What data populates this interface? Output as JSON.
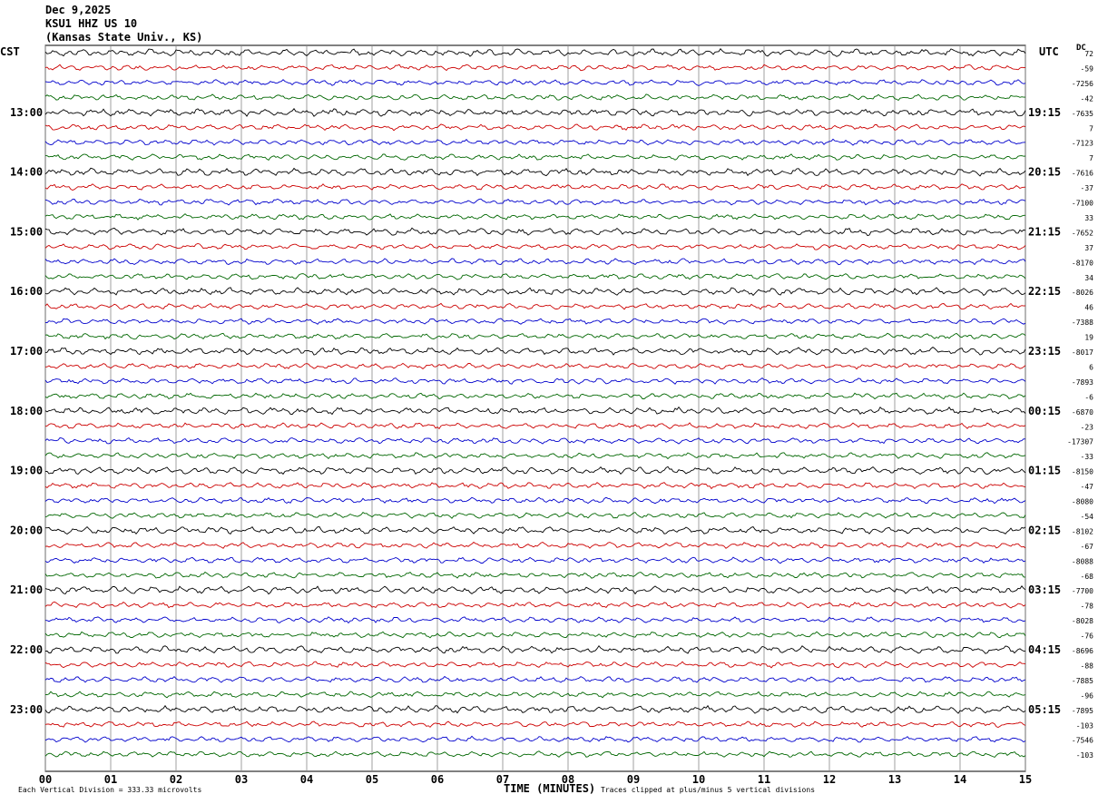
{
  "header": {
    "date": "Dec 9,2025",
    "station": "KSU1 HHZ US 10",
    "location": "(Kansas State Univ., KS)"
  },
  "left_zone_label": "CST",
  "right_zone_label": "UTC",
  "dc_label": "DC",
  "footer": {
    "scale_note": "Each Vertical Division =  333.33 microvolts",
    "xlabel": "TIME (MINUTES)",
    "clip_note": "Traces clipped at plus/minus 5 vertical divisions"
  },
  "colors": {
    "trace_cycle": [
      "#000000",
      "#cc0000",
      "#0000cc",
      "#006600"
    ],
    "grid": "#888888"
  },
  "chart_data": {
    "type": "line",
    "title": "",
    "xlabel": "TIME (MINUTES)",
    "xlim": [
      0,
      15
    ],
    "x_ticks": [
      "00",
      "01",
      "02",
      "03",
      "04",
      "05",
      "06",
      "07",
      "08",
      "09",
      "10",
      "11",
      "12",
      "13",
      "14",
      "15"
    ],
    "rows_per_hour": 4,
    "minutes_per_row": 15,
    "hour_labels_cst": [
      "13:00",
      "14:00",
      "15:00",
      "16:00",
      "17:00",
      "18:00",
      "19:00",
      "20:00",
      "21:00",
      "22:00",
      "23:00"
    ],
    "hour_labels_utc": [
      "19:15",
      "20:15",
      "21:15",
      "22:15",
      "23:15",
      "00:15",
      "01:15",
      "02:15",
      "03:15",
      "04:15",
      "05:15"
    ],
    "dc_offsets": [
      "72",
      "-59",
      "-7256",
      "-42",
      "-7635",
      "7",
      "-7123",
      "7",
      "-7616",
      "-37",
      "-7100",
      "33",
      "-7652",
      "37",
      "-8170",
      "34",
      "-8026",
      "46",
      "-7388",
      "19",
      "-8017",
      "6",
      "-7893",
      "-6",
      "-6870",
      "-23",
      "-17307",
      "-33",
      "-8150",
      "-47",
      "-8080",
      "-54",
      "-8102",
      "-67",
      "-8088",
      "-68",
      "-7700",
      "-78",
      "-8028",
      "-76",
      "-8696",
      "-88",
      "-7885",
      "-96",
      "-7895",
      "-103",
      "-7546",
      "-103"
    ],
    "trace_count": 48
  }
}
